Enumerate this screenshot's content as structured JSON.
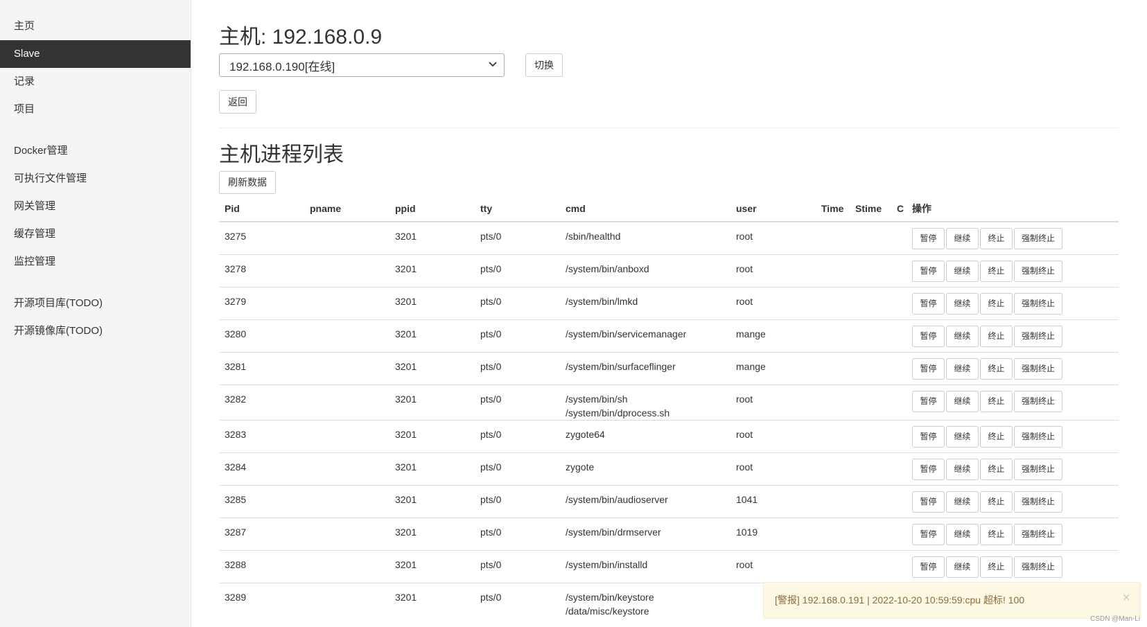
{
  "sidebar": {
    "items": [
      {
        "label": "主页"
      },
      {
        "label": "Slave",
        "active": true
      },
      {
        "label": "记录"
      },
      {
        "label": "项目"
      },
      {
        "label": "Docker管理"
      },
      {
        "label": "可执行文件管理"
      },
      {
        "label": "网关管理"
      },
      {
        "label": "缓存管理"
      },
      {
        "label": "监控管理"
      },
      {
        "label": "开源项目库(TODO)"
      },
      {
        "label": "开源镜像库(TODO)"
      }
    ]
  },
  "header": {
    "title": "主机: 192.168.0.9",
    "host_select_value": "192.168.0.190[在线]",
    "switch_label": "切换",
    "back_label": "返回"
  },
  "process_list": {
    "title": "主机进程列表",
    "refresh_label": "刷新数据",
    "columns": [
      "Pid",
      "pname",
      "ppid",
      "tty",
      "cmd",
      "user",
      "Time",
      "Stime",
      "C",
      "操作"
    ],
    "actions": [
      "暂停",
      "继续",
      "终止",
      "强制终止"
    ],
    "rows": [
      {
        "pid": "3275",
        "pname": "",
        "ppid": "3201",
        "tty": "pts/0",
        "cmd": "/sbin/healthd",
        "user": "root",
        "time": "",
        "stime": "",
        "c": ""
      },
      {
        "pid": "3278",
        "pname": "",
        "ppid": "3201",
        "tty": "pts/0",
        "cmd": "/system/bin/anboxd",
        "user": "root",
        "time": "",
        "stime": "",
        "c": ""
      },
      {
        "pid": "3279",
        "pname": "",
        "ppid": "3201",
        "tty": "pts/0",
        "cmd": "/system/bin/lmkd",
        "user": "root",
        "time": "",
        "stime": "",
        "c": ""
      },
      {
        "pid": "3280",
        "pname": "",
        "ppid": "3201",
        "tty": "pts/0",
        "cmd": "/system/bin/servicemanager",
        "user": "mange",
        "time": "",
        "stime": "",
        "c": ""
      },
      {
        "pid": "3281",
        "pname": "",
        "ppid": "3201",
        "tty": "pts/0",
        "cmd": "/system/bin/surfaceflinger",
        "user": "mange",
        "time": "",
        "stime": "",
        "c": ""
      },
      {
        "pid": "3282",
        "pname": "",
        "ppid": "3201",
        "tty": "pts/0",
        "cmd": "/system/bin/sh /system/bin/dprocess.sh",
        "user": "root",
        "time": "",
        "stime": "",
        "c": ""
      },
      {
        "pid": "3283",
        "pname": "",
        "ppid": "3201",
        "tty": "pts/0",
        "cmd": "zygote64",
        "user": "root",
        "time": "",
        "stime": "",
        "c": ""
      },
      {
        "pid": "3284",
        "pname": "",
        "ppid": "3201",
        "tty": "pts/0",
        "cmd": "zygote",
        "user": "root",
        "time": "",
        "stime": "",
        "c": ""
      },
      {
        "pid": "3285",
        "pname": "",
        "ppid": "3201",
        "tty": "pts/0",
        "cmd": "/system/bin/audioserver",
        "user": "1041",
        "time": "",
        "stime": "",
        "c": ""
      },
      {
        "pid": "3287",
        "pname": "",
        "ppid": "3201",
        "tty": "pts/0",
        "cmd": "/system/bin/drmserver",
        "user": "1019",
        "time": "",
        "stime": "",
        "c": ""
      },
      {
        "pid": "3288",
        "pname": "",
        "ppid": "3201",
        "tty": "pts/0",
        "cmd": "/system/bin/installd",
        "user": "root",
        "time": "",
        "stime": "",
        "c": ""
      },
      {
        "pid": "3289",
        "pname": "",
        "ppid": "3201",
        "tty": "pts/0",
        "cmd": "/system/bin/keystore /data/misc/keystore",
        "user": "",
        "time": "",
        "stime": "",
        "c": ""
      }
    ]
  },
  "alert": {
    "text": "[警报] 192.168.0.191 | 2022-10-20 10:59:59:cpu 超标!  100",
    "close_label": "×"
  },
  "watermark": "CSDN @Man-Li"
}
